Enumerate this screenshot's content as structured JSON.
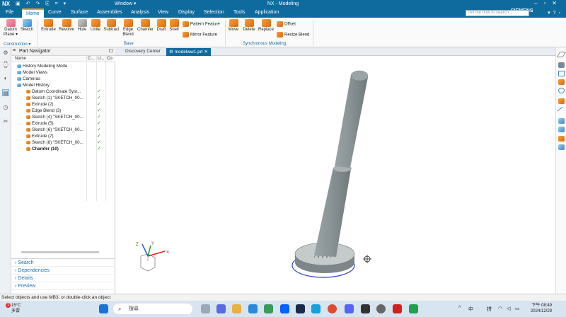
{
  "titlebar": {
    "logo": "NX",
    "window_menu": "Window ▾",
    "title": "NX - Modeling",
    "quick_access": "▣ ↶ ↷ ⎘ ⌗ ▾"
  },
  "menubar": {
    "items": [
      "File",
      "Home",
      "Curve",
      "Surface",
      "Assemblies",
      "Analysis",
      "View",
      "Display",
      "Selection",
      "Tools",
      "Application"
    ],
    "active": "Home",
    "search_placeholder": "Tell me how to search...",
    "brand": "SIEMENS"
  },
  "ribbon": {
    "datum_plane": "Datum Plane ▾",
    "sketch": "Sketch",
    "extrude": "Extrude",
    "revolve": "Revolve",
    "hole": "Hole",
    "unite": "Unite",
    "subtract": "Subtract",
    "edge_blend": "Edge Blend",
    "chamfer": "Chamfer",
    "draft": "Draft",
    "shell": "Shell",
    "pattern_feature": "Pattern Feature",
    "mirror_feature": "Mirror Feature",
    "move": "Move",
    "delete": "Delete",
    "replace": "Replace",
    "offset": "Offset",
    "resize_blend": "Resize Blend",
    "groups": {
      "construction": "Construction ▾",
      "base": "Base",
      "synchronous": "Synchronous Modeling"
    }
  },
  "navigator": {
    "title": "Part Navigator",
    "columns": {
      "name": "Name",
      "c": "C...",
      "u": "U...",
      "co": "Co"
    },
    "rows": [
      {
        "label": "History Modeling Mode",
        "indent": 0,
        "check": ""
      },
      {
        "label": "Model Views",
        "indent": 0,
        "check": ""
      },
      {
        "label": "Cameras",
        "indent": 0,
        "check": ""
      },
      {
        "label": "Model History",
        "indent": 0,
        "check": ""
      },
      {
        "label": "Datum Coordinate Syst...",
        "indent": 1,
        "check": "✓"
      },
      {
        "label": "Sketch (1) \"SKETCH_00...",
        "indent": 1,
        "check": "✓"
      },
      {
        "label": "Extrude (2)",
        "indent": 1,
        "check": "✓"
      },
      {
        "label": "Edge Blend (3)",
        "indent": 1,
        "check": "✓"
      },
      {
        "label": "Sketch (4) \"SKETCH_00...",
        "indent": 1,
        "check": "✓"
      },
      {
        "label": "Extrude (5)",
        "indent": 1,
        "check": "✓"
      },
      {
        "label": "Sketch (6) \"SKETCH_00...",
        "indent": 1,
        "check": "✓"
      },
      {
        "label": "Extrude (7)",
        "indent": 1,
        "check": "✓"
      },
      {
        "label": "Sketch (8) \"SKETCH_00...",
        "indent": 1,
        "check": "✓"
      },
      {
        "label": "Chamfer (10)",
        "indent": 1,
        "check": "✓"
      }
    ],
    "panes": [
      "Search",
      "Dependencies",
      "Details",
      "Preview"
    ]
  },
  "tabs": {
    "discovery": "Discovery Center",
    "model": "modelww1.prt"
  },
  "triad": {
    "x": "X",
    "y": "Y",
    "z": "Z"
  },
  "status": {
    "text": "Select objects and use MB3, or double-click an object"
  },
  "taskbar": {
    "temperature": "15°C",
    "weather_label": "多雲",
    "badge": "1",
    "search": "搜尋",
    "ime1": "中",
    "ime2": "拼",
    "time": "下午 08:49",
    "date": "2024/12/29"
  },
  "colors": {
    "accent": "#0f6a9e",
    "check_green": "#2a9a2a",
    "part_grey": "#8e989a"
  }
}
